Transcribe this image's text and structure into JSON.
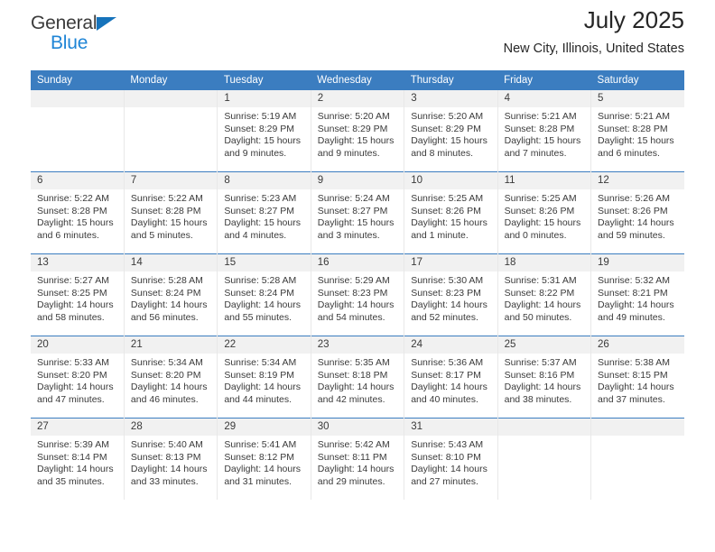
{
  "brand": {
    "name_top": "General",
    "name_bottom": "Blue",
    "triangle_color": "#1673bb",
    "blue_color": "#1f85d6"
  },
  "header": {
    "title": "July 2025",
    "subtitle": "New City, Illinois, United States"
  },
  "theme": {
    "header_bg": "#3b7dc0",
    "daynum_bg": "#f1f1f1",
    "row_divider": "#3b7dc0",
    "col_divider": "#e8e8e8",
    "text": "#3a3a3a"
  },
  "weekday_headers": [
    "Sunday",
    "Monday",
    "Tuesday",
    "Wednesday",
    "Thursday",
    "Friday",
    "Saturday"
  ],
  "weeks": [
    [
      {
        "day": "",
        "lines": []
      },
      {
        "day": "",
        "lines": []
      },
      {
        "day": "1",
        "lines": [
          "Sunrise: 5:19 AM",
          "Sunset: 8:29 PM",
          "Daylight: 15 hours",
          "and 9 minutes."
        ]
      },
      {
        "day": "2",
        "lines": [
          "Sunrise: 5:20 AM",
          "Sunset: 8:29 PM",
          "Daylight: 15 hours",
          "and 9 minutes."
        ]
      },
      {
        "day": "3",
        "lines": [
          "Sunrise: 5:20 AM",
          "Sunset: 8:29 PM",
          "Daylight: 15 hours",
          "and 8 minutes."
        ]
      },
      {
        "day": "4",
        "lines": [
          "Sunrise: 5:21 AM",
          "Sunset: 8:28 PM",
          "Daylight: 15 hours",
          "and 7 minutes."
        ]
      },
      {
        "day": "5",
        "lines": [
          "Sunrise: 5:21 AM",
          "Sunset: 8:28 PM",
          "Daylight: 15 hours",
          "and 6 minutes."
        ]
      }
    ],
    [
      {
        "day": "6",
        "lines": [
          "Sunrise: 5:22 AM",
          "Sunset: 8:28 PM",
          "Daylight: 15 hours",
          "and 6 minutes."
        ]
      },
      {
        "day": "7",
        "lines": [
          "Sunrise: 5:22 AM",
          "Sunset: 8:28 PM",
          "Daylight: 15 hours",
          "and 5 minutes."
        ]
      },
      {
        "day": "8",
        "lines": [
          "Sunrise: 5:23 AM",
          "Sunset: 8:27 PM",
          "Daylight: 15 hours",
          "and 4 minutes."
        ]
      },
      {
        "day": "9",
        "lines": [
          "Sunrise: 5:24 AM",
          "Sunset: 8:27 PM",
          "Daylight: 15 hours",
          "and 3 minutes."
        ]
      },
      {
        "day": "10",
        "lines": [
          "Sunrise: 5:25 AM",
          "Sunset: 8:26 PM",
          "Daylight: 15 hours",
          "and 1 minute."
        ]
      },
      {
        "day": "11",
        "lines": [
          "Sunrise: 5:25 AM",
          "Sunset: 8:26 PM",
          "Daylight: 15 hours",
          "and 0 minutes."
        ]
      },
      {
        "day": "12",
        "lines": [
          "Sunrise: 5:26 AM",
          "Sunset: 8:26 PM",
          "Daylight: 14 hours",
          "and 59 minutes."
        ]
      }
    ],
    [
      {
        "day": "13",
        "lines": [
          "Sunrise: 5:27 AM",
          "Sunset: 8:25 PM",
          "Daylight: 14 hours",
          "and 58 minutes."
        ]
      },
      {
        "day": "14",
        "lines": [
          "Sunrise: 5:28 AM",
          "Sunset: 8:24 PM",
          "Daylight: 14 hours",
          "and 56 minutes."
        ]
      },
      {
        "day": "15",
        "lines": [
          "Sunrise: 5:28 AM",
          "Sunset: 8:24 PM",
          "Daylight: 14 hours",
          "and 55 minutes."
        ]
      },
      {
        "day": "16",
        "lines": [
          "Sunrise: 5:29 AM",
          "Sunset: 8:23 PM",
          "Daylight: 14 hours",
          "and 54 minutes."
        ]
      },
      {
        "day": "17",
        "lines": [
          "Sunrise: 5:30 AM",
          "Sunset: 8:23 PM",
          "Daylight: 14 hours",
          "and 52 minutes."
        ]
      },
      {
        "day": "18",
        "lines": [
          "Sunrise: 5:31 AM",
          "Sunset: 8:22 PM",
          "Daylight: 14 hours",
          "and 50 minutes."
        ]
      },
      {
        "day": "19",
        "lines": [
          "Sunrise: 5:32 AM",
          "Sunset: 8:21 PM",
          "Daylight: 14 hours",
          "and 49 minutes."
        ]
      }
    ],
    [
      {
        "day": "20",
        "lines": [
          "Sunrise: 5:33 AM",
          "Sunset: 8:20 PM",
          "Daylight: 14 hours",
          "and 47 minutes."
        ]
      },
      {
        "day": "21",
        "lines": [
          "Sunrise: 5:34 AM",
          "Sunset: 8:20 PM",
          "Daylight: 14 hours",
          "and 46 minutes."
        ]
      },
      {
        "day": "22",
        "lines": [
          "Sunrise: 5:34 AM",
          "Sunset: 8:19 PM",
          "Daylight: 14 hours",
          "and 44 minutes."
        ]
      },
      {
        "day": "23",
        "lines": [
          "Sunrise: 5:35 AM",
          "Sunset: 8:18 PM",
          "Daylight: 14 hours",
          "and 42 minutes."
        ]
      },
      {
        "day": "24",
        "lines": [
          "Sunrise: 5:36 AM",
          "Sunset: 8:17 PM",
          "Daylight: 14 hours",
          "and 40 minutes."
        ]
      },
      {
        "day": "25",
        "lines": [
          "Sunrise: 5:37 AM",
          "Sunset: 8:16 PM",
          "Daylight: 14 hours",
          "and 38 minutes."
        ]
      },
      {
        "day": "26",
        "lines": [
          "Sunrise: 5:38 AM",
          "Sunset: 8:15 PM",
          "Daylight: 14 hours",
          "and 37 minutes."
        ]
      }
    ],
    [
      {
        "day": "27",
        "lines": [
          "Sunrise: 5:39 AM",
          "Sunset: 8:14 PM",
          "Daylight: 14 hours",
          "and 35 minutes."
        ]
      },
      {
        "day": "28",
        "lines": [
          "Sunrise: 5:40 AM",
          "Sunset: 8:13 PM",
          "Daylight: 14 hours",
          "and 33 minutes."
        ]
      },
      {
        "day": "29",
        "lines": [
          "Sunrise: 5:41 AM",
          "Sunset: 8:12 PM",
          "Daylight: 14 hours",
          "and 31 minutes."
        ]
      },
      {
        "day": "30",
        "lines": [
          "Sunrise: 5:42 AM",
          "Sunset: 8:11 PM",
          "Daylight: 14 hours",
          "and 29 minutes."
        ]
      },
      {
        "day": "31",
        "lines": [
          "Sunrise: 5:43 AM",
          "Sunset: 8:10 PM",
          "Daylight: 14 hours",
          "and 27 minutes."
        ]
      },
      {
        "day": "",
        "lines": []
      },
      {
        "day": "",
        "lines": []
      }
    ]
  ]
}
